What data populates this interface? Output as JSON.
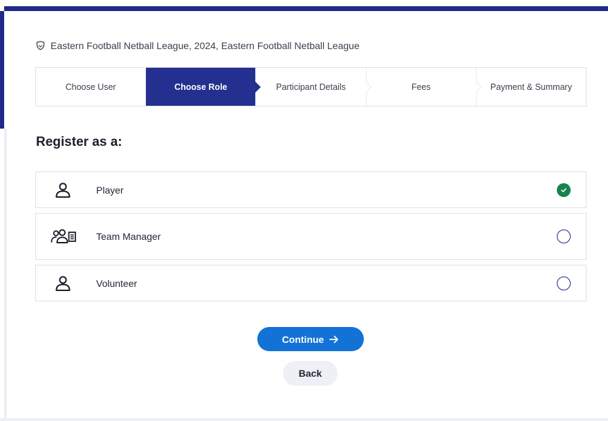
{
  "competition": {
    "name": "Eastern Football Netball League, 2024, Eastern Football Netball League",
    "icon": "shield-icon"
  },
  "steps": [
    {
      "label": "Choose User",
      "active": false
    },
    {
      "label": "Choose Role",
      "active": true
    },
    {
      "label": "Participant Details",
      "active": false
    },
    {
      "label": "Fees",
      "active": false
    },
    {
      "label": "Payment & Summary",
      "active": false
    }
  ],
  "heading": "Register as a:",
  "roles": [
    {
      "label": "Player",
      "icon": "person-icon",
      "selected": true
    },
    {
      "label": "Team Manager",
      "icon": "team-manager-icon",
      "selected": false
    },
    {
      "label": "Volunteer",
      "icon": "person-icon",
      "selected": false
    }
  ],
  "actions": {
    "continue_label": "Continue",
    "back_label": "Back"
  },
  "colors": {
    "brand_navy": "#23308f",
    "primary_blue": "#1272d6",
    "selected_green": "#17844d"
  }
}
